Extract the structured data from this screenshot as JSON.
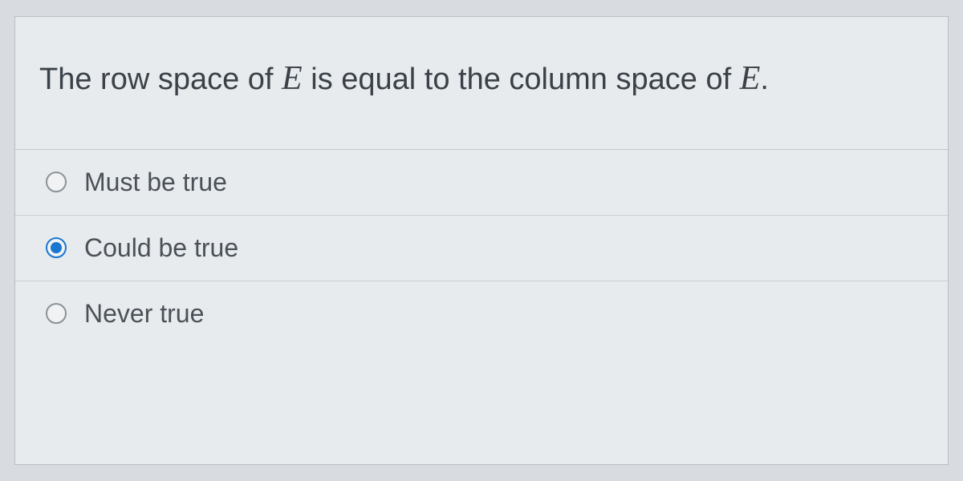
{
  "question": {
    "prefix": "The row space of ",
    "var1": "E",
    "middle": " is equal to the column space of ",
    "var2": "E",
    "suffix": "."
  },
  "options": [
    {
      "label": "Must be true",
      "selected": false
    },
    {
      "label": "Could be true",
      "selected": true
    },
    {
      "label": "Never true",
      "selected": false
    }
  ]
}
